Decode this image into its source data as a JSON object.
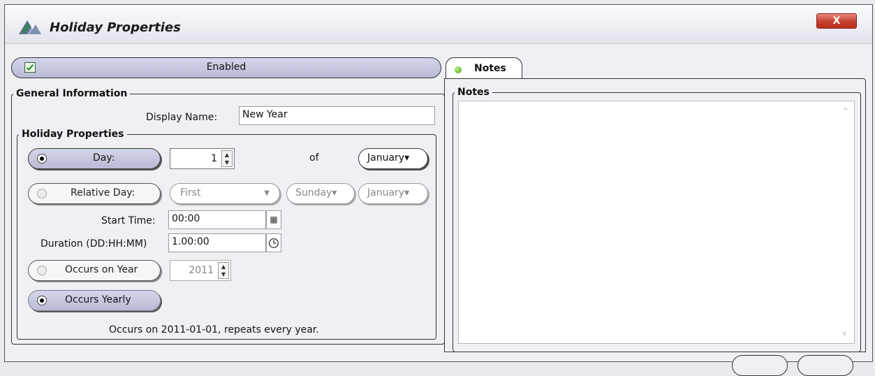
{
  "window": {
    "title": "Holiday Properties",
    "close_glyph": "X"
  },
  "enabled": {
    "label": "Enabled",
    "checked": true
  },
  "general": {
    "legend": "General Information",
    "display_name_label": "Display Name:",
    "display_name_value": "New Year"
  },
  "holiday": {
    "legend": "Holiday Properties",
    "day_label": "Day:",
    "day_value": "1",
    "of_label": "of",
    "month": "January",
    "relative_day_label": "Relative Day:",
    "relative_ordinal": "First",
    "relative_weekday": "Sunday",
    "relative_month": "January",
    "start_time_label": "Start Time:",
    "start_time_value": "00:00",
    "duration_label": "Duration (DD:HH:MM)",
    "duration_value": "1.00:00",
    "occurs_on_year_label": "Occurs on Year",
    "year_value": "2011",
    "occurs_yearly_label": "Occurs Yearly",
    "summary": "Occurs on 2011-01-01, repeats every year."
  },
  "notes": {
    "tab_label": "Notes",
    "legend": "Notes",
    "value": ""
  },
  "icons": [
    "app-logo-icon",
    "checkbox-checked-icon",
    "calendar-icon",
    "clock-icon",
    "status-dot-icon"
  ],
  "colors": {
    "pill_active": "#c8cae2",
    "close_red": "#c5402c",
    "status_green": "#3aa81f"
  }
}
